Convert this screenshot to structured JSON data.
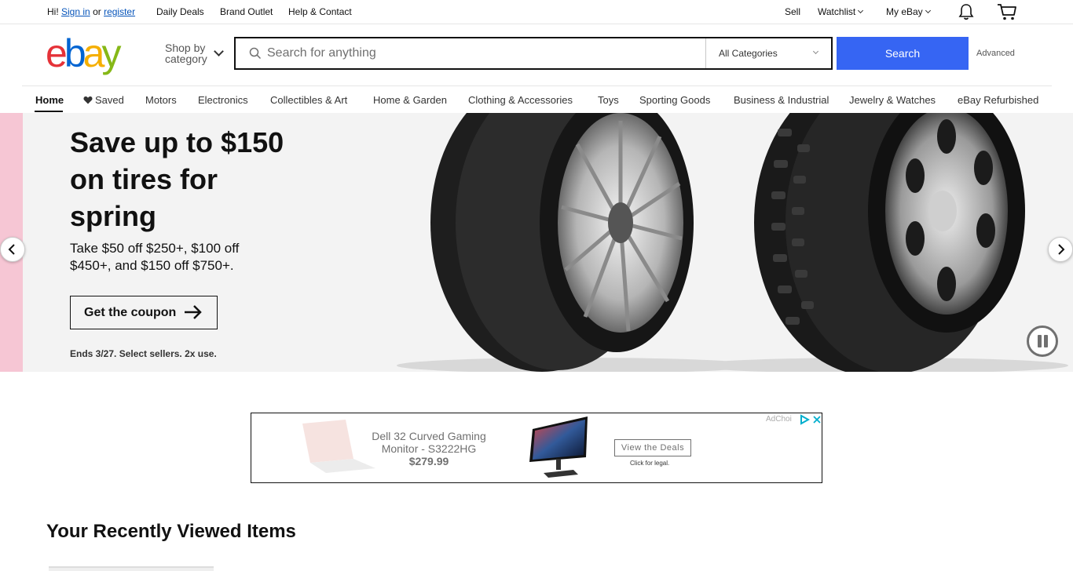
{
  "topbar": {
    "greeting": "Hi!",
    "sign_in": "Sign in",
    "or": "or",
    "register": "register",
    "daily_deals": "Daily Deals",
    "brand_outlet": "Brand Outlet",
    "help_contact": "Help & Contact",
    "sell": "Sell",
    "watchlist": "Watchlist",
    "my_ebay": "My eBay",
    "icons": [
      "bell-icon",
      "cart-icon"
    ]
  },
  "header": {
    "logo_letters": [
      "e",
      "b",
      "a",
      "y"
    ],
    "logo_colors": [
      "#e53238",
      "#0064d2",
      "#f5af02",
      "#86b817"
    ],
    "shop_by_category": [
      "Shop by",
      "category"
    ],
    "search": {
      "placeholder": "Search for anything",
      "value": "",
      "category_selected": "All Categories",
      "button": "Search"
    },
    "advanced": "Advanced",
    "accent_color": "#3665f3"
  },
  "nav": {
    "items": [
      {
        "label": "Home",
        "active": true
      },
      {
        "label": "Saved",
        "icon": "heart-icon"
      },
      {
        "label": "Motors"
      },
      {
        "label": "Electronics"
      },
      {
        "label": "Collectibles & Art"
      },
      {
        "label": "Home & Garden"
      },
      {
        "label": "Clothing & Accessories"
      },
      {
        "label": "Toys"
      },
      {
        "label": "Sporting Goods"
      },
      {
        "label": "Business & Industrial"
      },
      {
        "label": "Jewelry & Watches"
      },
      {
        "label": "eBay Refurbished"
      }
    ]
  },
  "hero": {
    "title_lines": [
      "Save up to $150",
      "on tires for",
      "spring"
    ],
    "subtitle_lines": [
      "Take $50 off $250+, $100 off",
      "$450+, and $150 off $750+."
    ],
    "cta": "Get the coupon",
    "fine_print": "Ends 3/27. Select sellers. 2x use.",
    "colors": {
      "background": "#f3f3f3",
      "left_strip": "#f6c6d4"
    }
  },
  "ad": {
    "title_lines": [
      "Dell 32 Curved Gaming",
      "Monitor - S3222HG"
    ],
    "price": "$279.99",
    "cta": "View the Deals",
    "legal": "Click for legal.",
    "adchoices": "AdChoi"
  },
  "recently_viewed": {
    "title": "Your Recently Viewed Items"
  }
}
